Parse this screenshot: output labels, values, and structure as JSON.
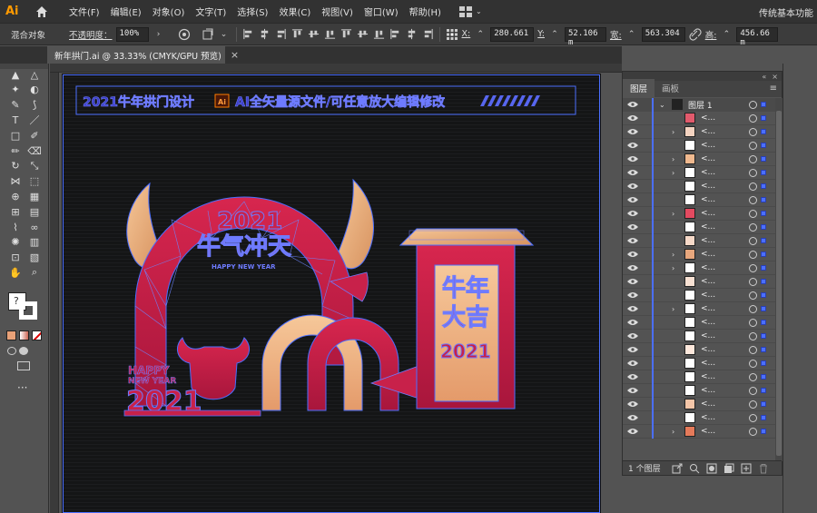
{
  "app": {
    "logo": "Ai",
    "menu": [
      "文件(F)",
      "编辑(E)",
      "对象(O)",
      "文字(T)",
      "选择(S)",
      "效果(C)",
      "视图(V)",
      "窗口(W)",
      "帮助(H)"
    ],
    "workspace": "传统基本功能"
  },
  "control": {
    "object_type": "混合对象",
    "opacity_label": "不透明度：",
    "opacity_value": "100%",
    "x_label": "X:",
    "x_value": "280.661",
    "y_label": "Y:",
    "y_value": "52.106 m",
    "w_label": "宽:",
    "w_value": "563.304",
    "h_label": "高:",
    "h_value": "456.66 m"
  },
  "document": {
    "tab_title": "新年拱门.ai @ 33.33% (CMYK/GPU 预览)"
  },
  "artwork": {
    "banner_text": "2021牛年拱门设计",
    "banner_text2": "AI全矢量源文件/可任意放大编辑修改",
    "banner_ai_badge": "Ai",
    "arch_year": "2021",
    "arch_title": "牛气冲天",
    "arch_subtitle": "HAPPY NEW YEAR",
    "bull_year": "2021",
    "bull_happy": "HAPPY",
    "bull_newyear": "NEW YEAR",
    "gate_line1": "牛年",
    "gate_line2": "大吉",
    "gate_year": "2021"
  },
  "layers_panel": {
    "tabs": [
      "图层",
      "画板"
    ],
    "top_layer": "图层 1",
    "rows": [
      {
        "name": "<...",
        "expand": false
      },
      {
        "name": "<...",
        "expand": true
      },
      {
        "name": "<...",
        "expand": false
      },
      {
        "name": "<...",
        "expand": true
      },
      {
        "name": "<...",
        "expand": true
      },
      {
        "name": "<...",
        "expand": false
      },
      {
        "name": "<...",
        "expand": false
      },
      {
        "name": "<...",
        "expand": true
      },
      {
        "name": "<...",
        "expand": false
      },
      {
        "name": "<...",
        "expand": false
      },
      {
        "name": "<...",
        "expand": true
      },
      {
        "name": "<...",
        "expand": true
      },
      {
        "name": "<...",
        "expand": false
      },
      {
        "name": "<...",
        "expand": false
      },
      {
        "name": "<...",
        "expand": true
      },
      {
        "name": "<...",
        "expand": false
      },
      {
        "name": "<...",
        "expand": false
      },
      {
        "name": "<...",
        "expand": false
      },
      {
        "name": "<...",
        "expand": false
      },
      {
        "name": "<...",
        "expand": false
      },
      {
        "name": "<...",
        "expand": false
      },
      {
        "name": "<...",
        "expand": false
      },
      {
        "name": "<...",
        "expand": false
      },
      {
        "name": "<...",
        "expand": true
      }
    ],
    "footer": "1 个图层"
  },
  "colors": {
    "accent_blue": "#4b6fff",
    "crimson": "#c8214a",
    "gold": "#e9b07f",
    "canvas_bg": "#141516"
  }
}
